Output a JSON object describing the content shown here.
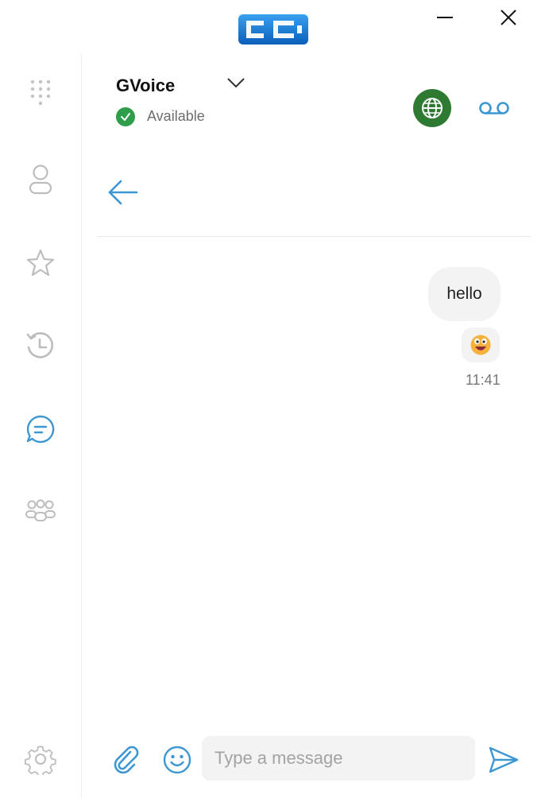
{
  "window": {
    "logo_icon": "cc-logo-icon",
    "minimize_icon": "minimize-icon",
    "close_icon": "close-icon"
  },
  "sidebar": {
    "items": [
      {
        "icon": "dialpad-icon"
      },
      {
        "icon": "contact-icon"
      },
      {
        "icon": "star-icon"
      },
      {
        "icon": "history-icon"
      },
      {
        "icon": "chat-icon",
        "active": true
      },
      {
        "icon": "group-icon"
      },
      {
        "icon": "settings-icon"
      }
    ]
  },
  "header": {
    "account_name": "GVoice",
    "status": "Available",
    "status_color": "#2e9e4a",
    "globe_color": "#2f7a32",
    "accent_color": "#3d97d3"
  },
  "conversation": {
    "messages": [
      {
        "text": "hello"
      },
      {
        "emoji": "grinning-face-emoji"
      }
    ],
    "time": "11:41"
  },
  "composer": {
    "placeholder": "Type a message"
  }
}
